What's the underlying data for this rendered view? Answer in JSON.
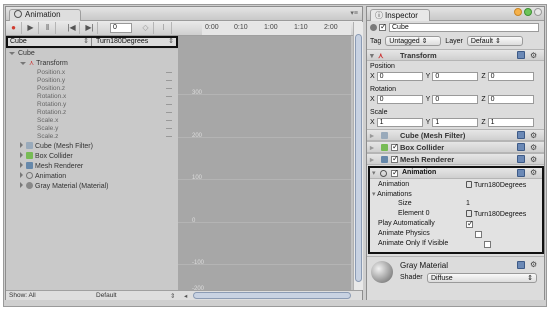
{
  "animation_window": {
    "tab_title": "Animation",
    "frame_value": "0",
    "object_dropdown": "Cube",
    "clip_dropdown": "Turn180Degrees",
    "ruler_ticks": [
      "0:00",
      "0:10",
      "1:00",
      "1:10",
      "2:00"
    ],
    "curve_labels": [
      "300",
      "200",
      "100",
      "0",
      "-100",
      "-200"
    ],
    "tree": {
      "root": "Cube",
      "transform_label": "Transform",
      "properties": [
        "Position.x",
        "Position.y",
        "Position.z",
        "Rotation.x",
        "Rotation.y",
        "Rotation.z",
        "Scale.x",
        "Scale.y",
        "Scale.z"
      ],
      "components": [
        "Cube (Mesh Filter)",
        "Box Collider",
        "Mesh Renderer",
        "Animation",
        "Gray Material (Material)"
      ]
    },
    "show_label": "Show: All",
    "wrap_label": "Default"
  },
  "inspector": {
    "tab_title": "Inspector",
    "object_name": "Cube",
    "tag_label": "Tag",
    "tag_value": "Untagged",
    "layer_label": "Layer",
    "layer_value": "Default",
    "transform_title": "Transform",
    "position_label": "Position",
    "position": {
      "x": "0",
      "y": "0",
      "z": "0"
    },
    "rotation_label": "Rotation",
    "rotation": {
      "x": "0",
      "y": "0",
      "z": "0"
    },
    "scale_label": "Scale",
    "scale": {
      "x": "1",
      "y": "1",
      "z": "1"
    },
    "axis": {
      "x": "X",
      "y": "Y",
      "z": "Z"
    },
    "mesh_filter_title": "Cube (Mesh Filter)",
    "box_collider_title": "Box Collider",
    "mesh_renderer_title": "Mesh Renderer",
    "animation_section": {
      "title": "Animation",
      "animation_label": "Animation",
      "animation_value": "Turn180Degrees",
      "animations_label": "Animations",
      "size_label": "Size",
      "size_value": "1",
      "element_label": "Element 0",
      "element_value": "Turn180Degrees",
      "play_auto_label": "Play Automatically",
      "play_auto": true,
      "physics_label": "Animate Physics",
      "physics": false,
      "visible_label": "Animate Only If Visible",
      "visible": false
    },
    "material_title": "Gray Material",
    "shader_label": "Shader",
    "shader_value": "Diffuse"
  },
  "colors": {
    "accent": "#8b9bb4",
    "record": "#d13a2e"
  }
}
